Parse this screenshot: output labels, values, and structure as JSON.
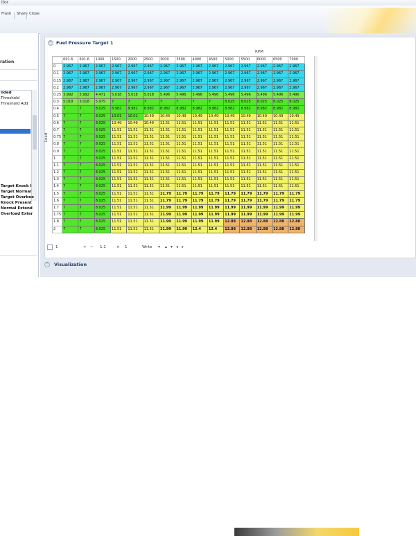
{
  "window": {
    "title_fragment": "itor"
  },
  "toolbar": {
    "items": [
      "Flash",
      "Share",
      "Close"
    ]
  },
  "sidebar": {
    "section_title": "ration",
    "items": [
      "nded",
      "Threshold",
      "Threshold Add"
    ],
    "bottom_items": [
      "Target Knock I",
      "Target Normal",
      "Target Overboo",
      "Knock Present",
      "Normal Extend",
      "Overload Exter"
    ]
  },
  "panel": {
    "title": "Fuel Pressure Target 1",
    "x_axis_label": "RPM",
    "y_axis_label": "Load"
  },
  "table": {
    "columns": [
      "601.6",
      "601.6",
      "1000",
      "1500",
      "2000",
      "2500",
      "3000",
      "3500",
      "4000",
      "4500",
      "5000",
      "5500",
      "6000",
      "6500",
      "7000"
    ],
    "rows": [
      {
        "label": "0",
        "values": [
          "2.967",
          "2.967",
          "2.967",
          "2.967",
          "2.967",
          "2.967",
          "2.967",
          "2.967",
          "2.967",
          "2.967",
          "2.967",
          "2.967",
          "2.967",
          "2.967",
          "2.967"
        ]
      },
      {
        "label": "0.1",
        "values": [
          "2.967",
          "2.967",
          "2.967",
          "2.967",
          "2.967",
          "2.967",
          "2.967",
          "2.967",
          "2.967",
          "2.967",
          "2.967",
          "2.967",
          "2.967",
          "2.967",
          "2.967"
        ]
      },
      {
        "label": "0.15",
        "values": [
          "2.967",
          "2.967",
          "2.967",
          "2.967",
          "2.967",
          "2.967",
          "2.967",
          "2.967",
          "2.967",
          "2.967",
          "2.967",
          "2.967",
          "2.967",
          "2.967",
          "2.967"
        ]
      },
      {
        "label": "0.2",
        "values": [
          "2.967",
          "2.967",
          "2.967",
          "2.967",
          "2.967",
          "2.967",
          "2.967",
          "2.967",
          "2.967",
          "2.967",
          "2.967",
          "2.967",
          "2.967",
          "2.967",
          "2.967"
        ]
      },
      {
        "label": "0.25",
        "values": [
          "3.992",
          "3.992",
          "4.471",
          "5.018",
          "5.018",
          "5.018",
          "5.496",
          "5.496",
          "5.496",
          "5.496",
          "5.496",
          "5.496",
          "5.496",
          "5.496",
          "5.496"
        ]
      },
      {
        "label": "0.3",
        "values": [
          "5.018",
          "5.018",
          "5.975",
          "7",
          "7",
          "7",
          "7",
          "7",
          "7",
          "7",
          "8.025",
          "8.025",
          "8.025",
          "8.025",
          "8.025"
        ]
      },
      {
        "label": "0.4",
        "values": [
          "7",
          "7",
          "8.025",
          "8.982",
          "8.982",
          "8.982",
          "8.982",
          "8.982",
          "8.982",
          "8.982",
          "8.982",
          "8.982",
          "8.982",
          "8.982",
          "8.982"
        ]
      },
      {
        "label": "0.5",
        "values": [
          "7",
          "7",
          "8.025",
          "10.01",
          "10.01",
          "10.49",
          "10.49",
          "10.49",
          "10.49",
          "10.49",
          "10.49",
          "10.49",
          "10.49",
          "10.49",
          "10.49"
        ]
      },
      {
        "label": "0.6",
        "values": [
          "7",
          "7",
          "8.025",
          "10.49",
          "10.49",
          "10.49",
          "11.51",
          "11.51",
          "11.51",
          "11.51",
          "11.51",
          "11.51",
          "11.51",
          "11.51",
          "11.51"
        ]
      },
      {
        "label": "0.7",
        "values": [
          "7",
          "7",
          "8.025",
          "11.51",
          "11.51",
          "11.51",
          "11.51",
          "11.51",
          "11.51",
          "11.51",
          "11.51",
          "11.51",
          "11.51",
          "11.51",
          "11.51"
        ]
      },
      {
        "label": "0.75",
        "values": [
          "7",
          "7",
          "8.025",
          "11.51",
          "11.51",
          "11.51",
          "11.51",
          "11.51",
          "11.51",
          "11.51",
          "11.51",
          "11.51",
          "11.51",
          "11.51",
          "11.51"
        ]
      },
      {
        "label": "0.8",
        "values": [
          "7",
          "7",
          "8.025",
          "11.51",
          "11.51",
          "11.51",
          "11.51",
          "11.51",
          "11.51",
          "11.51",
          "11.51",
          "11.51",
          "11.51",
          "11.51",
          "11.51"
        ]
      },
      {
        "label": "0.9",
        "values": [
          "7",
          "7",
          "8.025",
          "11.51",
          "11.51",
          "11.51",
          "11.51",
          "11.51",
          "11.51",
          "11.51",
          "11.51",
          "11.51",
          "11.51",
          "11.51",
          "11.51"
        ]
      },
      {
        "label": "1",
        "values": [
          "7",
          "7",
          "8.025",
          "11.51",
          "11.51",
          "11.51",
          "11.51",
          "11.51",
          "11.51",
          "11.51",
          "11.51",
          "11.51",
          "11.51",
          "11.51",
          "11.51"
        ]
      },
      {
        "label": "1.1",
        "values": [
          "7",
          "7",
          "8.025",
          "11.51",
          "11.51",
          "11.51",
          "11.51",
          "11.51",
          "11.51",
          "11.51",
          "11.51",
          "11.51",
          "11.51",
          "11.51",
          "11.51"
        ]
      },
      {
        "label": "1.2",
        "values": [
          "7",
          "7",
          "8.025",
          "11.51",
          "11.51",
          "11.51",
          "11.51",
          "11.51",
          "11.51",
          "11.51",
          "11.51",
          "11.51",
          "11.51",
          "11.51",
          "11.51"
        ]
      },
      {
        "label": "1.3",
        "values": [
          "7",
          "7",
          "8.025",
          "11.51",
          "11.51",
          "11.51",
          "11.51",
          "11.51",
          "11.51",
          "11.51",
          "11.51",
          "11.51",
          "11.51",
          "11.51",
          "11.51"
        ]
      },
      {
        "label": "1.4",
        "values": [
          "7",
          "7",
          "8.025",
          "11.51",
          "11.51",
          "11.51",
          "11.51",
          "11.51",
          "11.51",
          "11.51",
          "11.51",
          "11.51",
          "11.51",
          "11.51",
          "11.51"
        ]
      },
      {
        "label": "1.5",
        "values": [
          "7",
          "7",
          "8.025",
          "11.51",
          "11.51",
          "11.51",
          "11.79",
          "11.79",
          "11.79",
          "11.79",
          "11.79",
          "11.79",
          "11.79",
          "11.79",
          "11.79"
        ]
      },
      {
        "label": "1.6",
        "values": [
          "7",
          "7",
          "8.025",
          "11.51",
          "11.51",
          "11.51",
          "11.79",
          "11.79",
          "11.79",
          "11.79",
          "11.79",
          "11.79",
          "11.79",
          "11.79",
          "11.79"
        ]
      },
      {
        "label": "1.7",
        "values": [
          "7",
          "7",
          "8.025",
          "11.51",
          "11.51",
          "11.51",
          "11.99",
          "11.99",
          "11.99",
          "11.99",
          "11.99",
          "11.99",
          "11.99",
          "11.99",
          "11.99"
        ]
      },
      {
        "label": "1.75",
        "values": [
          "7",
          "7",
          "8.025",
          "11.51",
          "11.51",
          "11.51",
          "11.99",
          "11.99",
          "11.99",
          "11.99",
          "11.99",
          "11.99",
          "11.99",
          "11.99",
          "11.99"
        ]
      },
      {
        "label": "1.8",
        "values": [
          "7",
          "7",
          "8.025",
          "11.51",
          "11.51",
          "11.51",
          "11.99",
          "11.99",
          "11.99",
          "11.99",
          "12.88",
          "12.88",
          "12.88",
          "12.88",
          "12.88"
        ]
      },
      {
        "label": "2",
        "values": [
          "7",
          "7",
          "8.025",
          "11.51",
          "11.51",
          "11.51",
          "11.99",
          "11.99",
          "12.4",
          "12.4",
          "12.88",
          "12.88",
          "12.88",
          "12.88",
          "12.88"
        ]
      }
    ]
  },
  "colors": {
    "cyan": "#35d9ee",
    "lightgreen": "#7de94a",
    "green": "#52e52a",
    "yellow": "#f3f36a",
    "orange": "#f0b36a",
    "bold_threshold": 11.79
  },
  "bottombar": {
    "page": "1",
    "zoom": "1.1",
    "mult": "1",
    "mode": "Write"
  },
  "visualization": {
    "title": "Visualization"
  }
}
